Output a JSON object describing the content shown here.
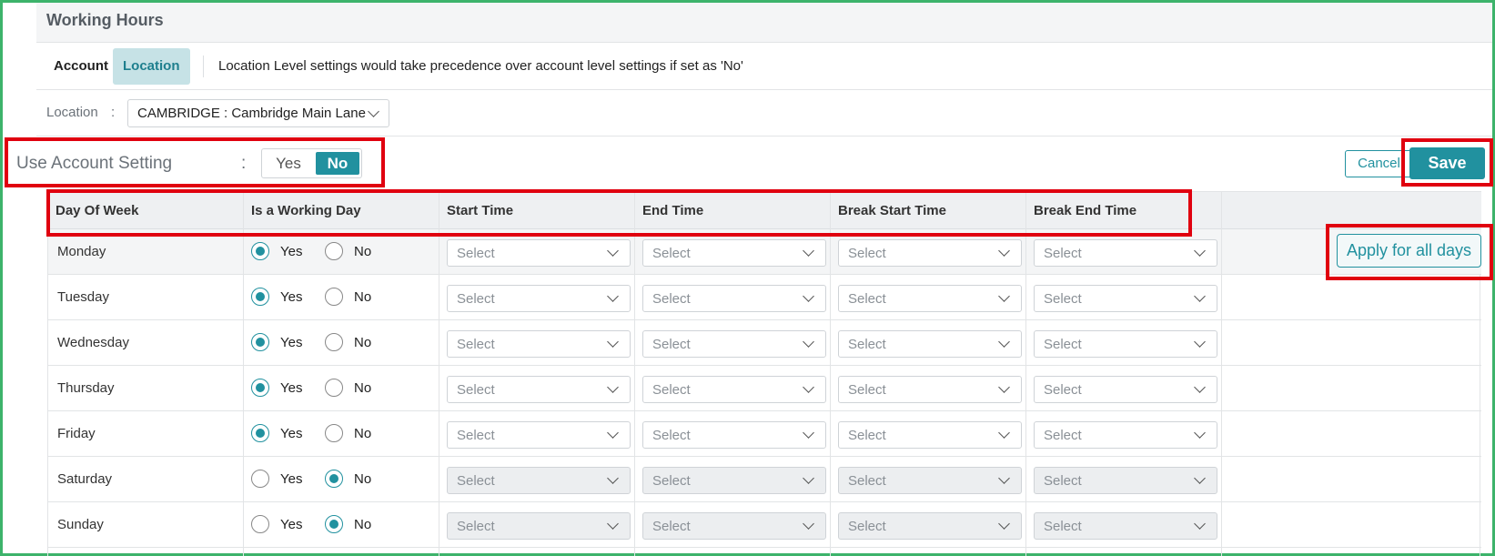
{
  "page": {
    "title": "Working Hours"
  },
  "tabs": [
    {
      "label": "Account"
    },
    {
      "label": "Location"
    }
  ],
  "tab_note": "Location Level settings would take precedence over account level settings if set as 'No'",
  "location": {
    "label": "Location",
    "colon": ":",
    "selected": "CAMBRIDGE : Cambridge Main Lane"
  },
  "use_account_setting": {
    "label": "Use Account Setting",
    "colon": ":",
    "yes_label": "Yes",
    "no_label": "No",
    "selected": "No"
  },
  "actions": {
    "cancel_label": "Cancel",
    "save_label": "Save",
    "apply_all_label": "Apply for all days"
  },
  "table": {
    "headers": [
      "Day Of Week",
      "Is a Working Day",
      "Start Time",
      "End Time",
      "Break Start Time",
      "Break End Time"
    ],
    "yes_label": "Yes",
    "no_label": "No",
    "select_placeholder": "Select",
    "rows": [
      {
        "day": "Monday",
        "working": "Yes"
      },
      {
        "day": "Tuesday",
        "working": "Yes"
      },
      {
        "day": "Wednesday",
        "working": "Yes"
      },
      {
        "day": "Thursday",
        "working": "Yes"
      },
      {
        "day": "Friday",
        "working": "Yes"
      },
      {
        "day": "Saturday",
        "working": "No"
      },
      {
        "day": "Sunday",
        "working": "No"
      }
    ]
  },
  "colors": {
    "accent": "#21919f",
    "highlight_border": "#e0000f",
    "frame_border": "#3db36b"
  }
}
